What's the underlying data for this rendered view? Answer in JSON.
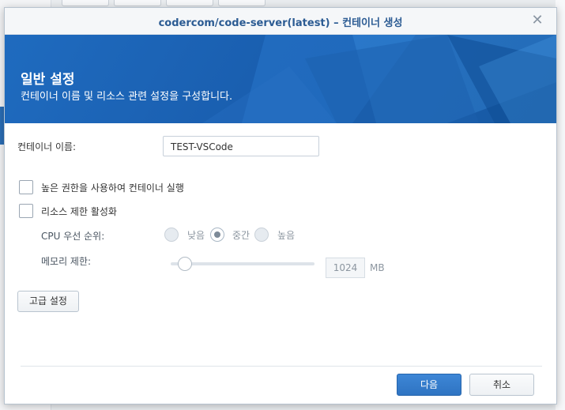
{
  "dialog": {
    "title": "codercom/code-server(latest) – 컨테이너 생성",
    "close_glyph": "✕"
  },
  "banner": {
    "heading": "일반 설정",
    "subtitle": "컨테이너 이름 및 리소스 관련 설정을 구성합니다."
  },
  "form": {
    "container_name_label": "컨테이너 이름:",
    "container_name_value": "TEST-VSCode",
    "privileged_label": "높은 권한을 사용하여 컨테이너 실행",
    "privileged_checked": false,
    "resource_limit_label": "리소스 제한 활성화",
    "resource_limit_checked": false,
    "cpu_priority_label": "CPU 우선 순위:",
    "cpu_options": [
      "낮음",
      "중간",
      "높음"
    ],
    "cpu_selected": "중간",
    "memory_label": "메모리 제한:",
    "memory_value": "1024",
    "memory_unit": "MB",
    "memory_slider_fraction": 0.1,
    "advanced_button": "고급 설정"
  },
  "footer": {
    "next_button": "다음",
    "cancel_button": "취소"
  },
  "colors": {
    "accent": "#2f74c2",
    "banner": "#1a5fb0",
    "title": "#2b5b93"
  }
}
